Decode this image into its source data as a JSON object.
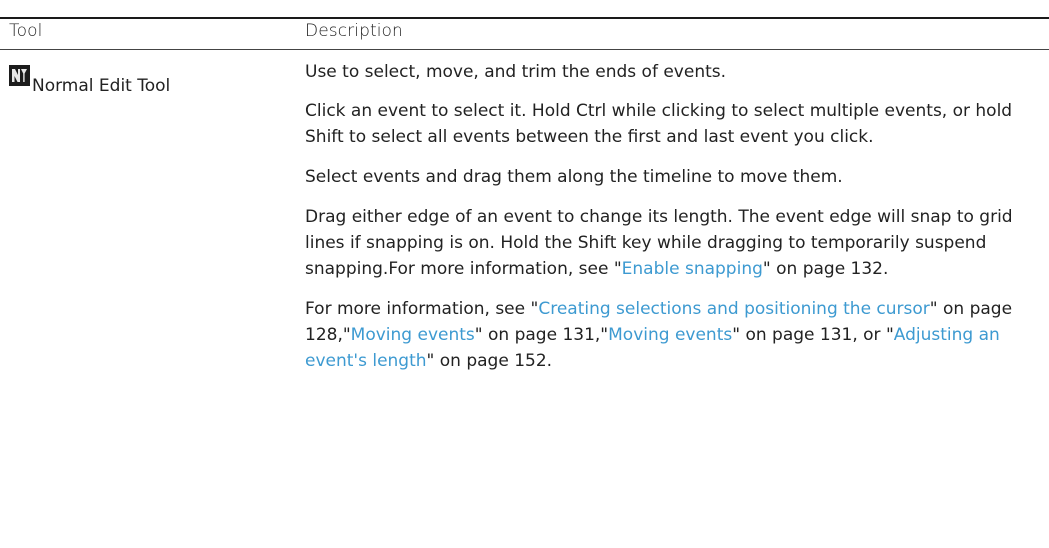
{
  "table": {
    "headers": {
      "tool": "Tool",
      "description": "Description"
    },
    "row": {
      "tool_name": "Normal Edit Tool",
      "tool_icon": "normal-edit-tool-icon",
      "paragraphs": {
        "p1": "Use to select, move, and trim the ends of events.",
        "p2": "Click an event to select it. Hold Ctrl while clicking to select multiple events, or hold Shift to select all events between the first and last event you click.",
        "p3": "Select events and drag them along the timeline to move them.",
        "p4": {
          "text_a": "Drag either edge of an event to change its length. The event edge will snap to grid lines if snapping is on. Hold the Shift key while dragging to temporarily suspend snapping.For more information, see \"",
          "link_a": "Enable snapping",
          "text_b": "\" on page 132."
        },
        "p5": {
          "text_a": "For more information, see \"",
          "link_a": "Creating selections and positioning the cursor",
          "text_b": "\" on page 128,\"",
          "link_b": "Moving events",
          "text_c": "\" on page 131,\"",
          "link_c": "Moving events",
          "text_d": "\" on page 131, or \"",
          "link_d": "Adjusting an event's length",
          "text_e": "\" on page 152."
        }
      }
    }
  },
  "colors": {
    "link": "#3d9ad1",
    "text": "#222222",
    "rule": "#1a1a1a"
  }
}
